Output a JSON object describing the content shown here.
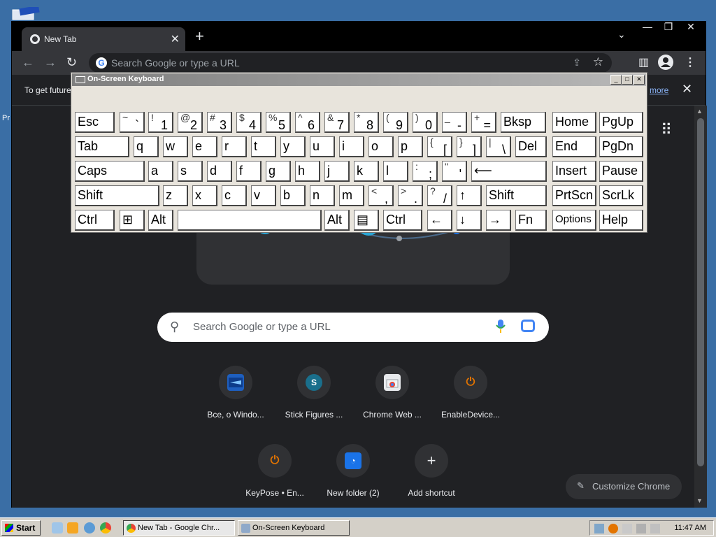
{
  "desktop": {
    "label": "Pr"
  },
  "browser": {
    "tab_title": "New Tab",
    "tab_close": "✕",
    "new_tab": "+",
    "tab_search": "⌄",
    "win_min": "—",
    "win_max": "❐",
    "win_close": "✕",
    "back": "←",
    "forward": "→",
    "reload": "↻",
    "omnibox_placeholder": "Search Google or type a URL",
    "share": "⇪",
    "bookmark": "☆",
    "side_panel": "▥",
    "menu": "⋮",
    "infobar_text": "To get future",
    "infobar_link": "more",
    "infobar_close": "✕"
  },
  "ntp": {
    "apps": "⠿",
    "search_placeholder": "Search Google or type a URL",
    "search_icon": "⚲",
    "shortcuts": [
      {
        "label": "Все, о Windo...",
        "glyph": "",
        "color": "#1e5fbf"
      },
      {
        "label": "Stick Figures ...",
        "glyph": "S",
        "color": "#1a6f8c"
      },
      {
        "label": "Chrome Web ...",
        "glyph": "",
        "color": "#e8eaed"
      },
      {
        "label": "EnableDevice...",
        "glyph": "⏻",
        "color": "#e37400"
      },
      {
        "label": "KeyPose • En...",
        "glyph": "⏻",
        "color": "#e37400"
      },
      {
        "label": "New folder (2)",
        "glyph": "◔",
        "color": "#1a73e8"
      },
      {
        "label": "Add shortcut",
        "glyph": "+",
        "color": "#303134"
      }
    ],
    "customize_label": "Customize Chrome",
    "customize_icon": "✎"
  },
  "osk": {
    "title": "On-Screen Keyboard",
    "btn_min": "_",
    "btn_max": "□",
    "btn_close": "✕",
    "rows": [
      [
        {
          "m": "Esc"
        },
        {
          "s": "~",
          "m": "`"
        },
        {
          "s": "!",
          "m": "1"
        },
        {
          "s": "@",
          "m": "2"
        },
        {
          "s": "#",
          "m": "3"
        },
        {
          "s": "$",
          "m": "4"
        },
        {
          "s": "%",
          "m": "5"
        },
        {
          "s": "^",
          "m": "6"
        },
        {
          "s": "&",
          "m": "7"
        },
        {
          "s": "*",
          "m": "8"
        },
        {
          "s": "(",
          "m": "9"
        },
        {
          "s": ")",
          "m": "0"
        },
        {
          "s": "_",
          "m": "-"
        },
        {
          "s": "+",
          "m": "="
        },
        {
          "m": "Bksp"
        },
        {
          "m": "Home"
        },
        {
          "m": "PgUp"
        }
      ],
      [
        {
          "m": "Tab"
        },
        {
          "m": "q"
        },
        {
          "m": "w"
        },
        {
          "m": "e"
        },
        {
          "m": "r"
        },
        {
          "m": "t"
        },
        {
          "m": "y"
        },
        {
          "m": "u"
        },
        {
          "m": "i"
        },
        {
          "m": "o"
        },
        {
          "m": "p"
        },
        {
          "s": "{",
          "m": "["
        },
        {
          "s": "}",
          "m": "]"
        },
        {
          "s": "|",
          "m": "\\"
        },
        {
          "m": "Del"
        },
        {
          "m": "End"
        },
        {
          "m": "PgDn"
        }
      ],
      [
        {
          "m": "Caps"
        },
        {
          "m": "a"
        },
        {
          "m": "s"
        },
        {
          "m": "d"
        },
        {
          "m": "f"
        },
        {
          "m": "g"
        },
        {
          "m": "h"
        },
        {
          "m": "j"
        },
        {
          "m": "k"
        },
        {
          "m": "l"
        },
        {
          "s": ":",
          "m": ";"
        },
        {
          "s": "\"",
          "m": "'"
        },
        {
          "m": "⟵"
        },
        {
          "m": "Insert"
        },
        {
          "m": "Pause"
        }
      ],
      [
        {
          "m": "Shift"
        },
        {
          "m": "z"
        },
        {
          "m": "x"
        },
        {
          "m": "c"
        },
        {
          "m": "v"
        },
        {
          "m": "b"
        },
        {
          "m": "n"
        },
        {
          "m": "m"
        },
        {
          "s": "<",
          "m": ","
        },
        {
          "s": ">",
          "m": "."
        },
        {
          "s": "?",
          "m": "/"
        },
        {
          "m": "↑"
        },
        {
          "m": "Shift"
        },
        {
          "m": "PrtScn"
        },
        {
          "m": "ScrLk"
        }
      ],
      [
        {
          "m": "Ctrl"
        },
        {
          "m": "⊞"
        },
        {
          "m": "Alt"
        },
        {
          "m": ""
        },
        {
          "m": "Alt"
        },
        {
          "m": "▤"
        },
        {
          "m": "Ctrl"
        },
        {
          "m": "←"
        },
        {
          "m": "↓"
        },
        {
          "m": "→"
        },
        {
          "m": "Fn"
        },
        {
          "m": "Options"
        },
        {
          "m": "Help"
        }
      ]
    ]
  },
  "taskbar": {
    "start": "Start",
    "tasks": [
      {
        "label": "New Tab - Google Chr...",
        "active": true
      },
      {
        "label": "On-Screen Keyboard",
        "active": false
      }
    ],
    "clock": "11:47 AM"
  }
}
